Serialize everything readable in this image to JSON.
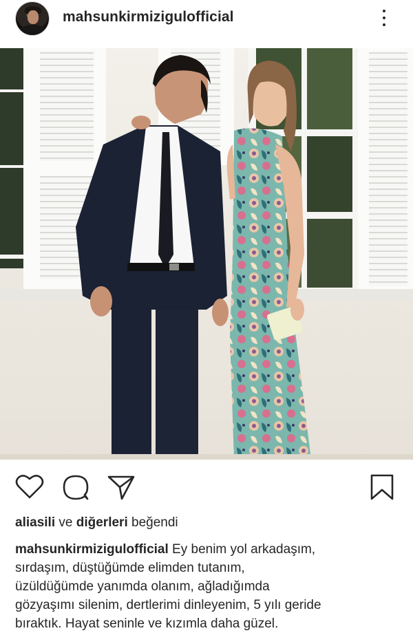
{
  "post": {
    "username": "mahsunkirmizigulofficial",
    "likes": {
      "user": "aliasili",
      "connector": "ve",
      "others": "diğerleri",
      "verb": "beğendi"
    },
    "caption": {
      "username": "mahsunkirmizigulofficial",
      "first_line": "Ey benim yol arkadaşım,",
      "lines": [
        "sırdaşım,  düştüğümde elimden tutanım,",
        "üzüldüğümde yanımda olanım, ağladığımda",
        "gözyaşımı silenim,  dertlerimi dinleyenim,  5 yılı geride",
        "bıraktık. Hayat seninle ve kızımla  daha  güzel."
      ]
    }
  },
  "icons": {
    "avatar": "profile-avatar",
    "more": "more-options-icon",
    "like": "heart-icon",
    "comment": "comment-icon",
    "share": "send-icon",
    "save": "bookmark-icon"
  },
  "colors": {
    "text": "#262626",
    "background": "#ffffff",
    "wall": "#f2efe9",
    "shutter": "#ffffff",
    "suit": "#1b2233",
    "dress_base": "#6aa9a0"
  }
}
